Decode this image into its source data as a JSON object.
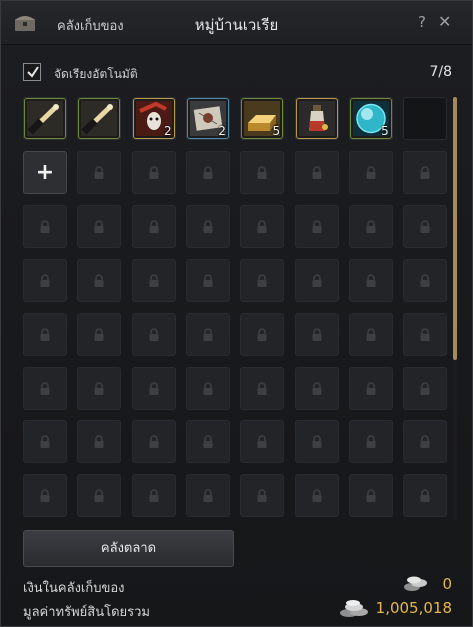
{
  "window": {
    "storage_tab": "คลังเก็บของ",
    "title": "หมู่บ้านเวเรีย",
    "help": "?",
    "close": "✕"
  },
  "autosort": {
    "label": "จัดเรียงอัตโนมัติ",
    "checked": true
  },
  "capacity": "7/8",
  "inventory": {
    "items": [
      {
        "icon": "fishing-rod-icon",
        "count": ""
      },
      {
        "icon": "fishing-rod-icon",
        "count": ""
      },
      {
        "icon": "red-mask-icon",
        "count": "2"
      },
      {
        "icon": "treasure-map-icon",
        "count": "2"
      },
      {
        "icon": "gold-bar-icon",
        "count": "5"
      },
      {
        "icon": "potion-vial-icon",
        "count": ""
      },
      {
        "icon": "blue-orb-icon",
        "count": "5"
      }
    ],
    "empty_slots": 1,
    "add_slot_label": "+",
    "locked_slots": 55,
    "scroll_position": 0,
    "scroll_visible_fraction": 0.62
  },
  "market_button": "คลังตลาด",
  "money": {
    "label": "เงินในคลังเก็บของ",
    "value": "0"
  },
  "worth": {
    "label": "มูลค่าทรัพย์สินโดยรวม",
    "value": "1,005,018"
  },
  "colors": {
    "gold_text": "#e7b64e",
    "scroll_thumb": "#a78a5a"
  }
}
